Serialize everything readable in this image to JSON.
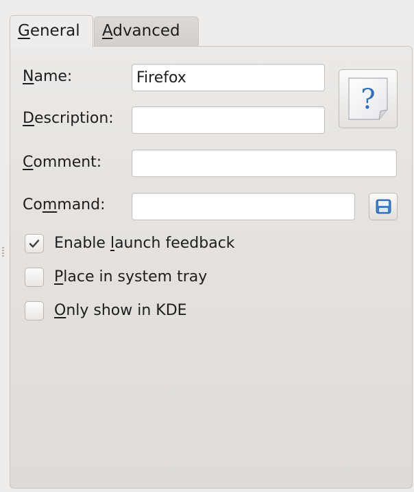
{
  "tabs": [
    {
      "prefix": "",
      "mnemonic": "G",
      "rest": "eneral"
    },
    {
      "prefix": "",
      "mnemonic": "A",
      "rest": "dvanced"
    }
  ],
  "fields": {
    "name": {
      "prefix": "",
      "mnemonic": "N",
      "rest": "ame:",
      "value": "Firefox"
    },
    "description": {
      "prefix": "",
      "mnemonic": "D",
      "rest": "escription:",
      "value": ""
    },
    "comment": {
      "prefix": "",
      "mnemonic": "C",
      "rest": "omment:",
      "value": ""
    },
    "command": {
      "prefix": "Co",
      "mnemonic": "m",
      "rest": "mand:",
      "value": ""
    }
  },
  "checkboxes": [
    {
      "prefix": "Enable ",
      "mnemonic": "l",
      "rest": "aunch feedback",
      "checked": true
    },
    {
      "prefix": "",
      "mnemonic": "P",
      "rest": "lace in system tray",
      "checked": false
    },
    {
      "prefix": "",
      "mnemonic": "O",
      "rest": "nly show in KDE",
      "checked": false
    }
  ],
  "icons": {
    "app_icon": "unknown-file-icon",
    "browse": "save-icon",
    "check": "checkmark-icon"
  },
  "colors": {
    "accent": "#2f6fb5",
    "window_bg": "#efedec"
  }
}
